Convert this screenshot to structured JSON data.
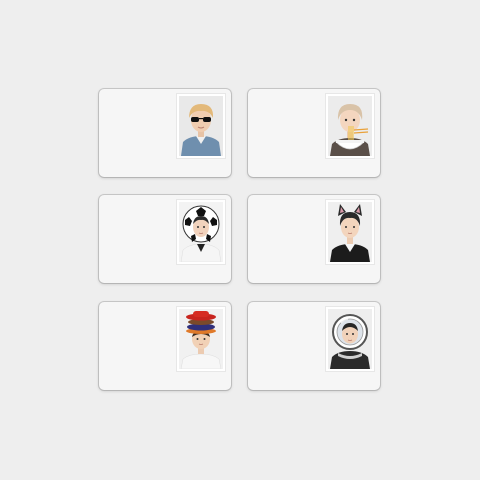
{
  "cards": [
    {
      "id": "card-1",
      "photo_subject": "person-with-sunglasses"
    },
    {
      "id": "card-2",
      "photo_subject": "person-with-noodle-bowl"
    },
    {
      "id": "card-3",
      "photo_subject": "person-with-soccer-ball-hood"
    },
    {
      "id": "card-4",
      "photo_subject": "person-with-cat-ears"
    },
    {
      "id": "card-5",
      "photo_subject": "person-with-stacked-hats"
    },
    {
      "id": "card-6",
      "photo_subject": "person-with-astronaut-helmet"
    }
  ],
  "colors": {
    "background": "#eeeeee",
    "card": "#f6f6f6",
    "photo_border": "#ffffff"
  }
}
